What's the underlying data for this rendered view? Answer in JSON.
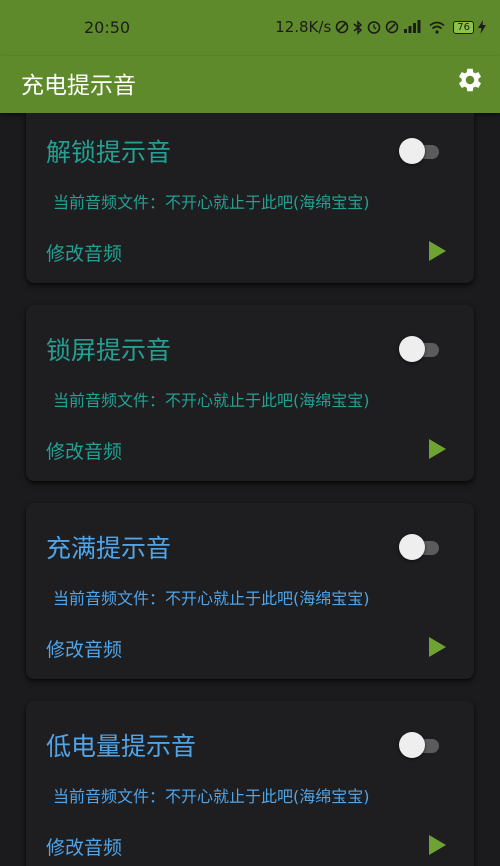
{
  "status_bar": {
    "time": "20:50",
    "network_speed": "12.8K/s",
    "battery": "76"
  },
  "app_bar": {
    "title": "充电提示音"
  },
  "cards": [
    {
      "title": "解锁提示音",
      "file_text": "当前音频文件：不开心就止于此吧(海绵宝宝)",
      "modify_label": "修改音频",
      "enabled": false,
      "text_color": "#23a092"
    },
    {
      "title": "锁屏提示音",
      "file_text": "当前音频文件：不开心就止于此吧(海绵宝宝)",
      "modify_label": "修改音频",
      "enabled": false,
      "text_color": "#23a092"
    },
    {
      "title": "充满提示音",
      "file_text": "当前音频文件：不开心就止于此吧(海绵宝宝)",
      "modify_label": "修改音频",
      "enabled": false,
      "text_color": "#50a4e8"
    },
    {
      "title": "低电量提示音",
      "file_text": "当前音频文件：不开心就止于此吧(海绵宝宝)",
      "modify_label": "修改音频",
      "enabled": false,
      "text_color": "#50a4e8"
    }
  ],
  "colors": {
    "app_bar": "#5f8a2b",
    "background": "#1b1b1d",
    "card": "#1e1e20",
    "play_icon": "#6ea334",
    "toggle_off_track": "#5b5b5e"
  },
  "icons": {
    "settings": "gear-icon",
    "play": "play-icon"
  }
}
